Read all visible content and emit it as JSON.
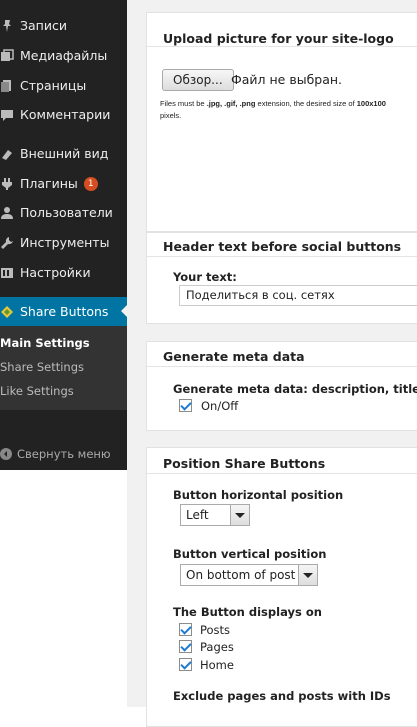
{
  "sidebar": {
    "items": [
      {
        "label": "Записи",
        "icon": "pin-icon"
      },
      {
        "label": "Медиафайлы",
        "icon": "media-icon"
      },
      {
        "label": "Страницы",
        "icon": "pages-icon"
      },
      {
        "label": "Комментарии",
        "icon": "comment-icon"
      },
      {
        "label": "Внешний вид",
        "icon": "appearance-icon"
      },
      {
        "label": "Плагины",
        "icon": "plugin-icon",
        "badge": "1"
      },
      {
        "label": "Пользователи",
        "icon": "users-icon"
      },
      {
        "label": "Инструменты",
        "icon": "tools-icon"
      },
      {
        "label": "Настройки",
        "icon": "settings-icon"
      }
    ],
    "active": {
      "label": "Share Buttons",
      "icon": "share-icon"
    },
    "submenu": [
      {
        "label": "Main Settings"
      },
      {
        "label": "Share Settings"
      },
      {
        "label": "Like Settings"
      }
    ],
    "collapse_label": "Свернуть меню",
    "accent_color": "#0074a2",
    "badge_color": "#d54e21"
  },
  "logo_box": {
    "title": "Upload picture for your site-logo",
    "browse_label": "Обзор...",
    "file_status": "Файл не выбран.",
    "hint_prefix": "Files must be ",
    "hint_formats": ".jpg, .gif, .png",
    "hint_middle": " extension, the desired size of ",
    "hint_size": "100x100",
    "hint_suffix": "pixels."
  },
  "header_box": {
    "title": "Header text before social buttons",
    "your_text_label": "Your text:",
    "your_text_value": "Поделиться в соц. сетях"
  },
  "meta_box": {
    "title": "Generate meta data",
    "field_label": "Generate meta data: description, title:",
    "checkbox_label": "On/Off",
    "checked": true
  },
  "position_box": {
    "title": "Position Share Buttons",
    "horizontal_label": "Button horizontal position",
    "horizontal_value": "Left",
    "vertical_label": "Button vertical position",
    "vertical_value": "On bottom of post",
    "displays_label": "The Button displays on",
    "displays_options": [
      {
        "label": "Posts",
        "checked": true
      },
      {
        "label": "Pages",
        "checked": true
      },
      {
        "label": "Home",
        "checked": true
      }
    ],
    "exclude_label": "Exclude pages and posts with IDs"
  }
}
